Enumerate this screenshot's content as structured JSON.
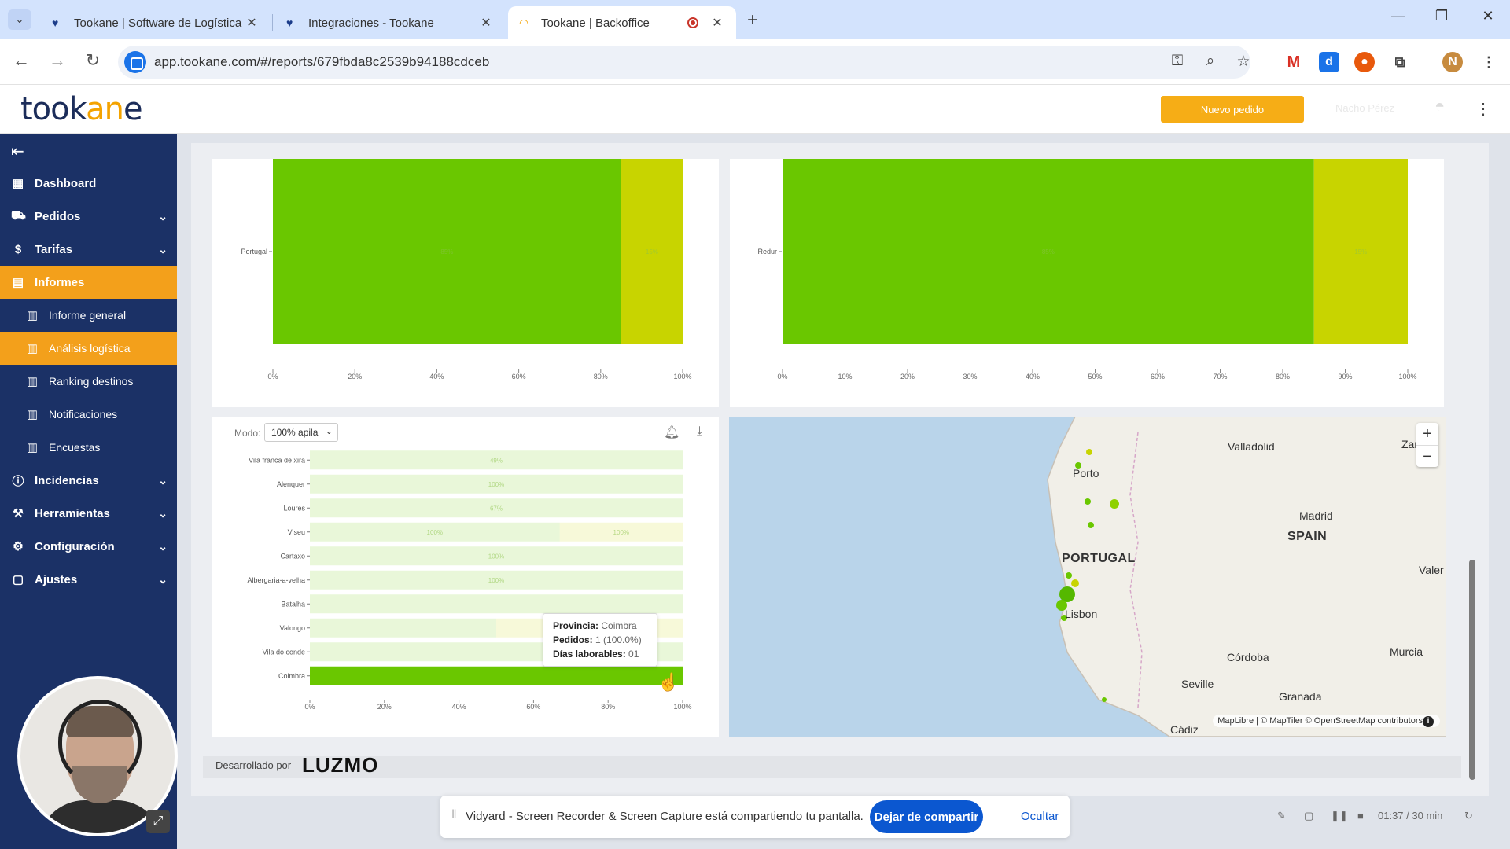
{
  "browser": {
    "tabs": [
      {
        "title": "Tookane | Software de Logística"
      },
      {
        "title": "Integraciones - Tookane"
      },
      {
        "title": "Tookane | Backoffice"
      }
    ],
    "url": "app.tookane.com/#/reports/679fbda8c2539b94188cdceb"
  },
  "header": {
    "logo_text": "took",
    "logo_accent": "an",
    "logo_end": "e",
    "new_order_label": "Nuevo pedido",
    "user_name": "Nacho Pérez"
  },
  "sidebar": {
    "items": [
      {
        "label": "Dashboard",
        "icon": "dashboard-icon"
      },
      {
        "label": "Pedidos",
        "icon": "truck-icon"
      },
      {
        "label": "Tarifas",
        "icon": "dollar-icon"
      },
      {
        "label": "Informes",
        "icon": "report-icon"
      },
      {
        "label": "Informe general",
        "icon": "table-icon"
      },
      {
        "label": "Análisis logística",
        "icon": "table-icon"
      },
      {
        "label": "Ranking destinos",
        "icon": "table-icon"
      },
      {
        "label": "Notificaciones",
        "icon": "table-icon"
      },
      {
        "label": "Encuestas",
        "icon": "table-icon"
      },
      {
        "label": "Incidencias",
        "icon": "alert-icon"
      },
      {
        "label": "Herramientas",
        "icon": "toolbox-icon"
      },
      {
        "label": "Configuración",
        "icon": "gear-icon"
      },
      {
        "label": "Ajustes",
        "icon": "briefcase-icon"
      }
    ]
  },
  "bottom_left_card": {
    "mode_label": "Modo:",
    "mode_value": "100% apila"
  },
  "tooltip": {
    "k1": "Provincia:",
    "v1": "Coimbra",
    "k2": "Pedidos:",
    "v2": "1 (100.0%)",
    "k3": "Días laborables:",
    "v3": "01"
  },
  "map": {
    "labels": [
      "Valladolid",
      "Porto",
      "Madrid",
      "SPAIN",
      "PORTUGAL",
      "Lisbon",
      "Valer",
      "Córdoba",
      "Murcia",
      "Seville",
      "Granada",
      "Cádiz",
      "Zara"
    ],
    "attribution": "MapLibre | © MapTiler © OpenStreetMap contributors",
    "zoom_in": "+",
    "zoom_out": "−"
  },
  "footer": {
    "powered_label": "Desarrollado por",
    "brand": "LUZMO"
  },
  "share_bar": {
    "text": "Vidyard - Screen Recorder & Screen Capture está compartiendo tu pantalla.",
    "stop_label": "Dejar de compartir",
    "hide_label": "Ocultar"
  },
  "recorder": {
    "time": "01:37 / 30 min"
  },
  "colors": {
    "sidebar_bg": "#1b3166",
    "accent": "#f3a01b",
    "bar_green": "#6ac700",
    "bar_yellow": "#c8d400"
  },
  "chart_data": [
    {
      "type": "bar",
      "orientation": "horizontal",
      "stacked": "100%",
      "categories": [
        "Portugal"
      ],
      "series": [
        {
          "values": [
            85
          ]
        },
        {
          "values": [
            15
          ]
        }
      ],
      "data_labels": [
        "85%",
        "15%"
      ],
      "xticks": [
        "0%",
        "20%",
        "40%",
        "60%",
        "80%",
        "100%"
      ],
      "xlim": [
        0,
        100
      ]
    },
    {
      "type": "bar",
      "orientation": "horizontal",
      "stacked": "100%",
      "categories": [
        "Redur"
      ],
      "series": [
        {
          "values": [
            85
          ]
        },
        {
          "values": [
            15
          ]
        }
      ],
      "data_labels": [
        "85%",
        "15%"
      ],
      "xticks": [
        "0%",
        "10%",
        "20%",
        "30%",
        "40%",
        "50%",
        "60%",
        "70%",
        "80%",
        "90%",
        "100%"
      ],
      "xlim": [
        0,
        100
      ]
    },
    {
      "type": "bar",
      "orientation": "horizontal",
      "stacked": "100%",
      "categories": [
        "Vila franca de xira",
        "Alenquer",
        "Loures",
        "Viseu",
        "Cartaxo",
        "Albergaria-a-velha",
        "Batalha",
        "Valongo",
        "Vila do conde",
        "Coimbra"
      ],
      "series": [
        {
          "values": [
            100,
            100,
            100,
            67,
            100,
            100,
            100,
            50,
            100,
            100
          ]
        },
        {
          "values": [
            0,
            0,
            0,
            33,
            0,
            0,
            0,
            50,
            0,
            0
          ]
        }
      ],
      "data_labels": [
        "49%",
        "0%",
        "100%",
        "100%",
        "67%",
        "33%",
        "100%",
        "100%",
        "100%",
        "50%",
        "100%",
        "100%"
      ],
      "highlighted": "Coimbra",
      "xticks": [
        "0%",
        "20%",
        "40%",
        "60%",
        "80%",
        "100%"
      ],
      "xlim": [
        0,
        100
      ]
    }
  ]
}
